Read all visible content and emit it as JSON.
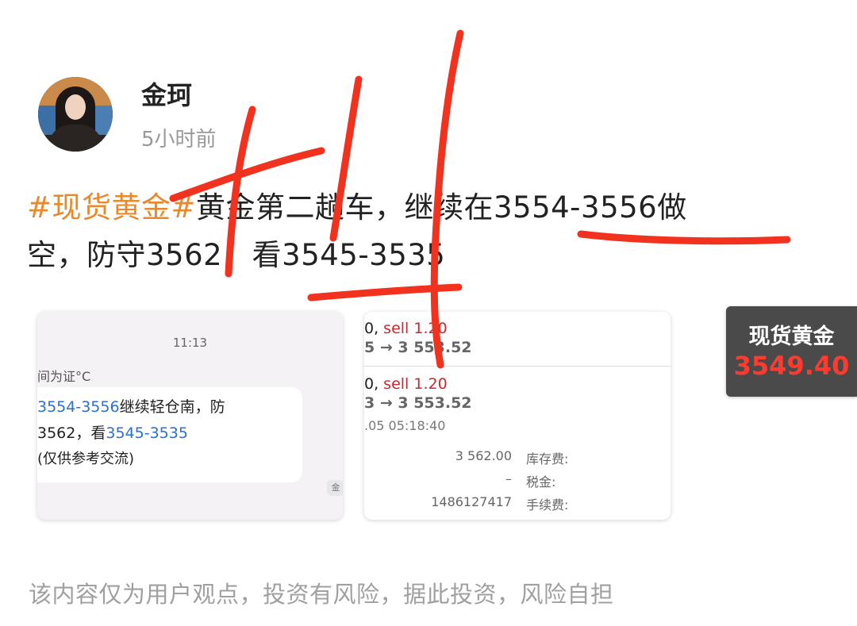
{
  "author": {
    "name": "金珂",
    "time": "5小时前"
  },
  "post": {
    "hashtag": "#现货黄金#",
    "line1_rest": "黄金第二趟车，继续在3554-3556做",
    "line2": "空，防守3562，看3545-3535"
  },
  "screenshot_left": {
    "time": "11:13",
    "note": "间为证°C",
    "line1_link": "3554-3556",
    "line1_text": "继续轻仓南，防",
    "line2_text1": "3562，看",
    "line2_link": "3545-3535",
    "line3_text": "(仅供参考交流)",
    "mini_avatar": "金"
  },
  "screenshot_right": {
    "row1": {
      "prefix": "0, ",
      "type": "sell",
      "qty": "1.20",
      "price": "5 → 3 553.52"
    },
    "row2": {
      "prefix": "0, ",
      "type": "sell",
      "qty": "1.20",
      "price": "3 → 3 553.52",
      "datetime": ".05 05:18:40",
      "details": [
        {
          "value": "3 562.00",
          "label": "库存费:"
        },
        {
          "value": "–",
          "label": "税金:"
        },
        {
          "value": "1486127417",
          "label": "手续费:"
        }
      ]
    }
  },
  "price_widget": {
    "title": "现货黄金",
    "price": "3549.40",
    "price_color": "#ff3b2f"
  },
  "disclaimer": "该内容仅为用户观点，投资有风险，据此投资，风险自担",
  "colors": {
    "hashtag": "#e8892c",
    "sell": "#c9282d",
    "scribble": "#f0321e",
    "link": "#2b6fd0"
  }
}
